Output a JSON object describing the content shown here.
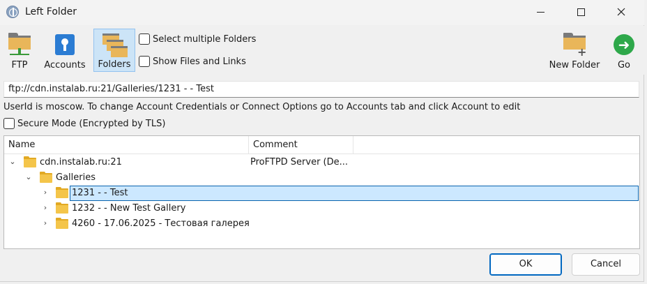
{
  "window": {
    "title": "Left Folder",
    "icon": "globe-icon"
  },
  "toolbar": {
    "ftp_label": "FTP",
    "accounts_label": "Accounts",
    "folders_label": "Folders",
    "new_folder_label": "New Folder",
    "go_label": "Go",
    "go_glyph": "➜",
    "plus_glyph": "+"
  },
  "options": {
    "select_multiple": "Select multiple Folders",
    "show_files": "Show Files and Links",
    "secure_mode": "Secure Mode (Encrypted by TLS)"
  },
  "path": {
    "value": "ftp://cdn.instalab.ru:21/Galleries/1231 - - Test"
  },
  "info": {
    "text": "UserId is moscow. To change Account Credentials or Connect Options go to Accounts tab and click Account to edit"
  },
  "tree": {
    "columns": [
      "Name",
      "Comment"
    ],
    "rows": [
      {
        "name": "cdn.instalab.ru:21",
        "comment": "ProFTPD Server (De...",
        "expander": "⌄"
      },
      {
        "name": "Galleries",
        "comment": "",
        "expander": "⌄"
      },
      {
        "name": "1231 - - Test",
        "comment": "",
        "expander": "›",
        "selected": true
      },
      {
        "name": "1232 - - New Test Gallery",
        "comment": "",
        "expander": "›"
      },
      {
        "name": "4260 - 17.06.2025 - Тестовая галерея",
        "comment": "",
        "expander": "›"
      }
    ]
  },
  "buttons": {
    "ok": "OK",
    "cancel": "Cancel"
  },
  "colors": {
    "selection": "#cce8ff",
    "selection_border": "#0a64ad",
    "accent": "#0067c0",
    "folder": "#f4c54a",
    "go": "#2ea84a"
  }
}
